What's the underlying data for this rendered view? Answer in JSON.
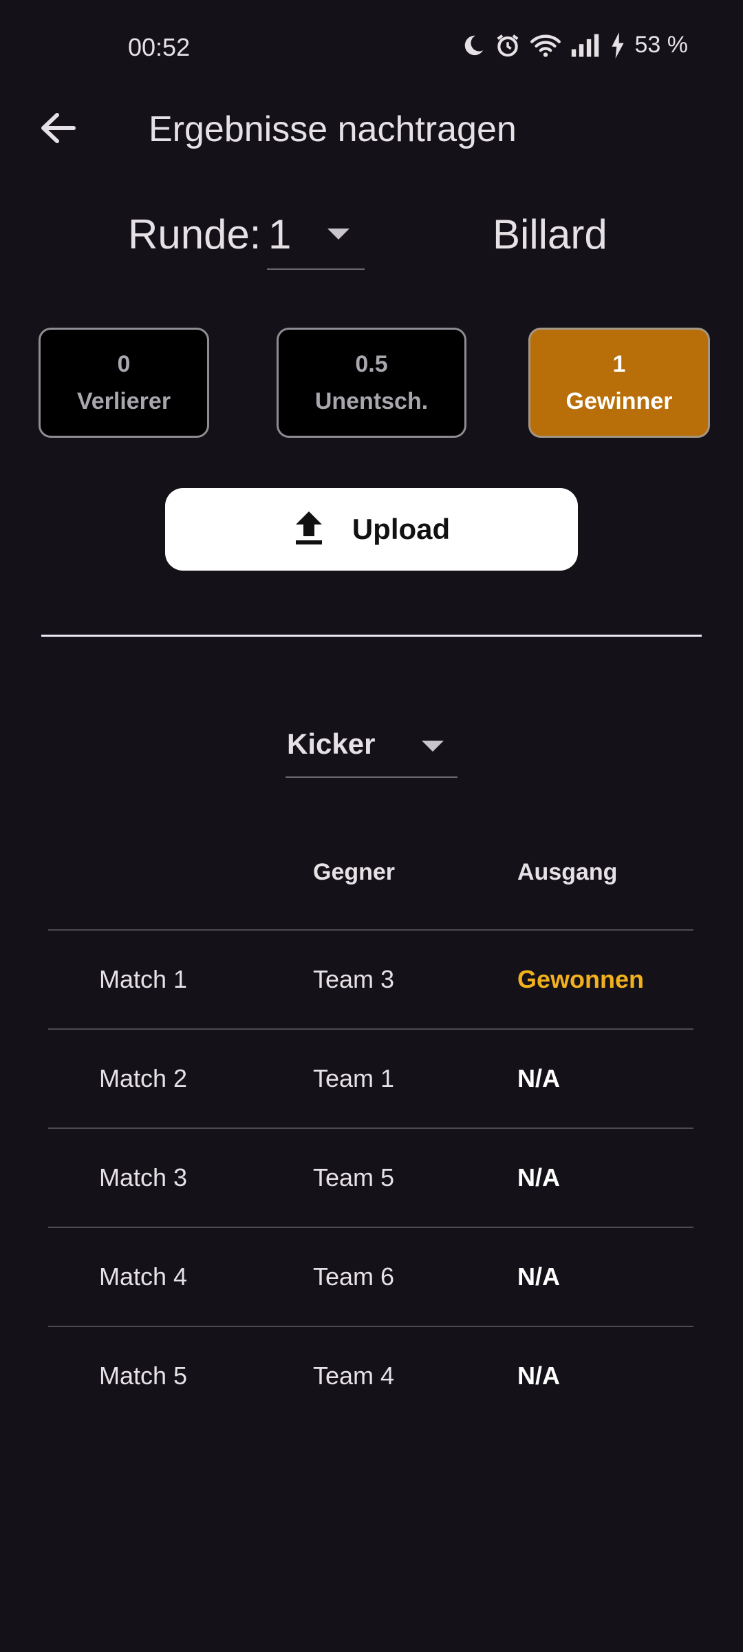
{
  "status_bar": {
    "time": "00:52",
    "battery_percent": "53 %",
    "icons": [
      "moon-icon",
      "alarm-icon",
      "wifi-icon",
      "signal-icon",
      "charging-icon"
    ]
  },
  "app_bar": {
    "title": "Ergebnisse nachtragen",
    "back_icon": "arrow-left-icon"
  },
  "round": {
    "label": "Runde:",
    "value": "1"
  },
  "game": {
    "name": "Billard"
  },
  "score_buttons": [
    {
      "value": "0",
      "label": "Verlierer",
      "selected": false
    },
    {
      "value": "0.5",
      "label": "Unentsch.",
      "selected": false
    },
    {
      "value": "1",
      "label": "Gewinner",
      "selected": true
    }
  ],
  "upload": {
    "label": "Upload",
    "icon": "upload-icon"
  },
  "filter": {
    "selected": "Kicker"
  },
  "table": {
    "headers": {
      "match": "",
      "opponent": "Gegner",
      "outcome": "Ausgang"
    },
    "rows": [
      {
        "match": "Match 1",
        "opponent": "Team 3",
        "outcome": "Gewonnen"
      },
      {
        "match": "Match 2",
        "opponent": "Team 1",
        "outcome": "N/A"
      },
      {
        "match": "Match 3",
        "opponent": "Team 5",
        "outcome": "N/A"
      },
      {
        "match": "Match 4",
        "opponent": "Team 6",
        "outcome": "N/A"
      },
      {
        "match": "Match 5",
        "opponent": "Team 4",
        "outcome": "N/A"
      }
    ]
  },
  "colors": {
    "background": "#141218",
    "accent": "#B86E09",
    "won": "#F2B01E",
    "text": "#E6E1E5"
  }
}
